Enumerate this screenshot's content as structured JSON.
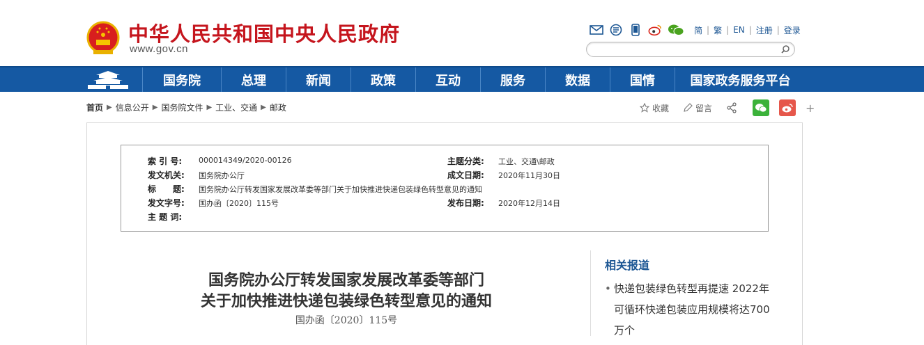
{
  "header": {
    "site_title": "中华人民共和国中央人民政府",
    "site_url": "www.gov.cn",
    "lang_links": [
      "简",
      "繁",
      "EN",
      "注册",
      "登录"
    ],
    "search_placeholder": ""
  },
  "nav": {
    "items": [
      {
        "label": "国务院",
        "width": 93
      },
      {
        "label": "总理",
        "width": 93
      },
      {
        "label": "新闻",
        "width": 93
      },
      {
        "label": "政策",
        "width": 93
      },
      {
        "label": "互动",
        "width": 93
      },
      {
        "label": "服务",
        "width": 93
      },
      {
        "label": "数据",
        "width": 93
      },
      {
        "label": "国情",
        "width": 93
      },
      {
        "label": "国家政务服务平台",
        "width": 200
      }
    ]
  },
  "breadcrumb": [
    "首页",
    "信息公开",
    "国务院文件",
    "工业、交通",
    "邮政"
  ],
  "share": {
    "favorite_label": "收藏",
    "comment_label": "留言",
    "plus": "+"
  },
  "info": {
    "index_label": "索 引 号:",
    "index_value": "000014349/2020-00126",
    "theme_label": "主题分类:",
    "theme_value": "工业、交通\\邮政",
    "issuer_label": "发文机关:",
    "issuer_value": "国务院办公厅",
    "created_label": "成文日期:",
    "created_value": "2020年11月30日",
    "title_label": "标　　题:",
    "title_value": "国务院办公厅转发国家发展改革委等部门关于加快推进快递包装绿色转型意见的通知",
    "docno_label": "发文字号:",
    "docno_value": "国办函〔2020〕115号",
    "published_label": "发布日期:",
    "published_value": "2020年12月14日",
    "keywords_label": "主 题 词:",
    "keywords_value": ""
  },
  "document": {
    "title_line1": "国务院办公厅转发国家发展改革委等部门",
    "title_line2": "关于加快推进快递包装绿色转型意见的通知",
    "doc_number": "国办函〔2020〕115号"
  },
  "related": {
    "title": "相关报道",
    "items": [
      "快递包装绿色转型再提速 2022年可循环快递包装应用规模将达700万个"
    ]
  },
  "colors": {
    "brand_red": "#c5151d",
    "nav_blue": "#1559a3",
    "link_blue": "#1c5693",
    "wechat_green": "#3bb23a",
    "weibo_red": "#e6574b"
  }
}
